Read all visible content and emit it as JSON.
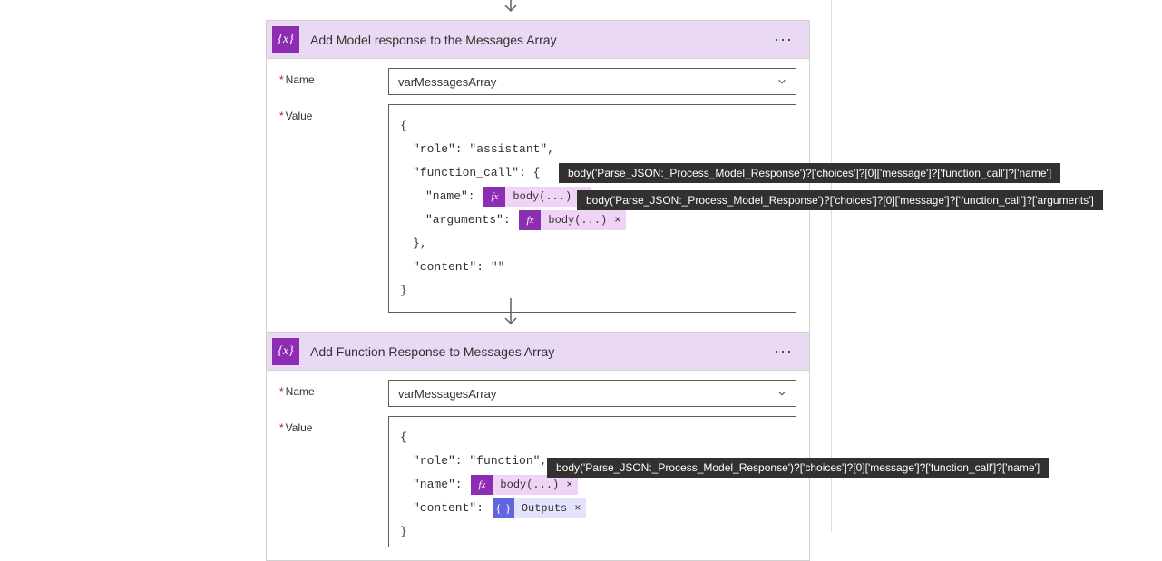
{
  "arrow_connector": "↓",
  "card1": {
    "icon_glyph": "{x}",
    "title": "Add Model response to the Messages Array",
    "more_glyph": "···",
    "name_label": "Name",
    "name_value": "varMessagesArray",
    "value_label": "Value",
    "json_lines": {
      "l0": "{",
      "l1": "\"role\": \"assistant\",",
      "l2": "\"function_call\": {",
      "l3_pre": "\"name\": ",
      "l3_token": "body(...)",
      "l3_post": " ,",
      "l4_pre": "\"arguments\": ",
      "l4_token": "body(...)",
      "l5": "},",
      "l6": "\"content\": \"\"",
      "l7": "}"
    },
    "tooltips": {
      "name": "body('Parse_JSON:_Process_Model_Response')?['choices']?[0]['message']?['function_call']?['name']",
      "arguments": "body('Parse_JSON:_Process_Model_Response')?['choices']?[0]['message']?['function_call']?['arguments']"
    }
  },
  "card2": {
    "icon_glyph": "{x}",
    "title": "Add Function Response to Messages Array",
    "more_glyph": "···",
    "name_label": "Name",
    "name_value": "varMessagesArray",
    "value_label": "Value",
    "json_lines": {
      "l0": "{",
      "l1": "\"role\": \"function\",",
      "l2_pre": "\"name\": ",
      "l2_token": "body(...)",
      "l3_pre": "\"content\": ",
      "l3_token": "Outputs",
      "l4": "}"
    },
    "tooltips": {
      "name": "body('Parse_JSON:_Process_Model_Response')?['choices']?[0]['message']?['function_call']?['name']"
    }
  },
  "token_ui": {
    "fx": "fx",
    "out_glyph": "{·}",
    "close": "×"
  }
}
